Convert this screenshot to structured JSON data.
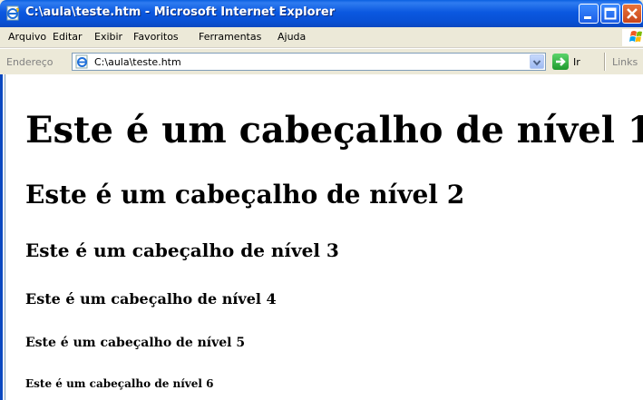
{
  "window": {
    "title": "C:\\aula\\teste.htm - Microsoft Internet Explorer"
  },
  "menu": {
    "items": [
      "Arquivo",
      "Editar",
      "Exibir",
      "Favoritos",
      "Ferramentas",
      "Ajuda"
    ]
  },
  "addressbar": {
    "label": "Endereço",
    "value": "C:\\aula\\teste.htm",
    "go_label": "Ir",
    "links_label": "Links"
  },
  "content": {
    "h1": "Este é um cabeçalho de nível 1",
    "h2": "Este é um cabeçalho de nível 2",
    "h3": "Este é um cabeçalho de nível 3",
    "h4": "Este é um cabeçalho de nível 4",
    "h5": "Este é um cabeçalho de nível 5",
    "h6": "Este é um cabeçalho de nível 6"
  },
  "colors": {
    "titlebar": "#0a58e0",
    "close_button": "#c8451b",
    "go_button": "#1f9a2e"
  },
  "icons": [
    "ie-page-icon",
    "minimize-icon",
    "maximize-icon",
    "close-icon",
    "windows-logo-icon",
    "dropdown-arrow-icon",
    "go-arrow-icon"
  ]
}
